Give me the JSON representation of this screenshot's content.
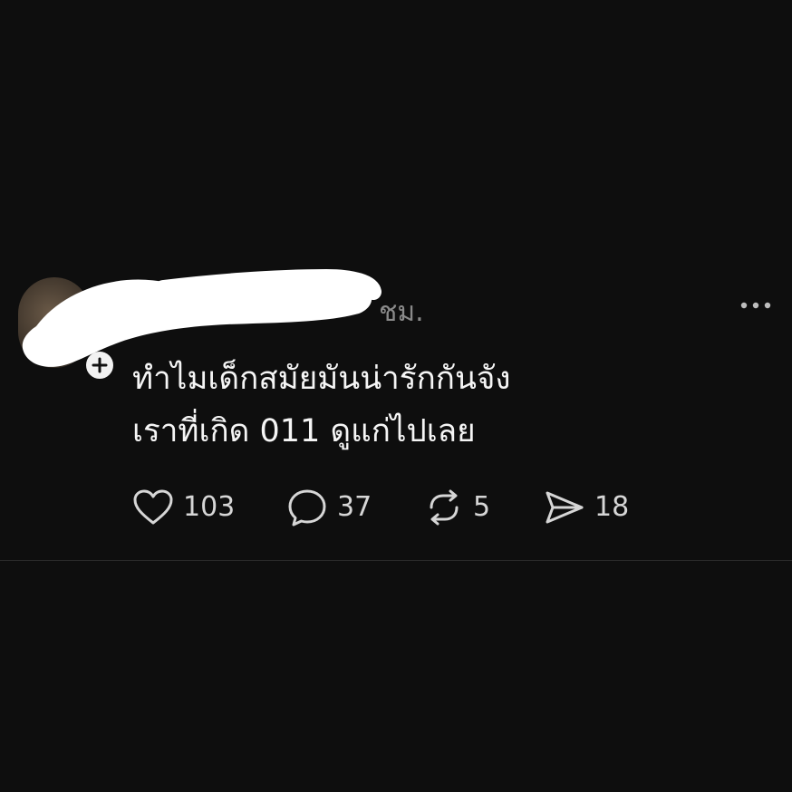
{
  "post": {
    "time": "ชม.",
    "text_line_1": "ทำไมเด็กสมัยมันน่ารักกันจัง",
    "text_line_2": "เราที่เกิด 011 ดูแก่ไปเลย",
    "avatar_icon": "avatar",
    "follow_icon": "plus-icon",
    "more_icon": "more-horizontal-icon"
  },
  "actions": {
    "likes": "103",
    "replies": "37",
    "reposts": "5",
    "shares": "18",
    "like_icon": "heart-icon",
    "reply_icon": "comment-bubble-icon",
    "repost_icon": "repost-icon",
    "share_icon": "send-icon"
  },
  "colors": {
    "background": "#0e0e0e",
    "text": "#f5f5f5",
    "muted": "#8a8a8a",
    "redaction": "#ffffff"
  }
}
